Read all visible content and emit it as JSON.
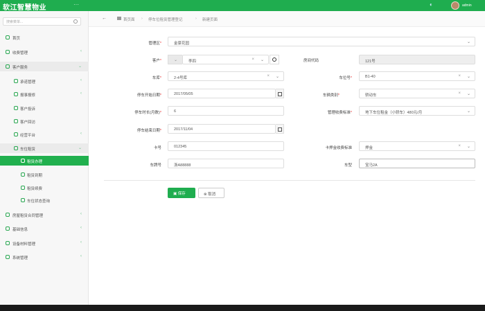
{
  "header": {
    "brand": "软江智慧物业",
    "menu_toggle": "···",
    "user": "admin",
    "colors": {
      "accent": "#1fad4f"
    }
  },
  "sidebar": {
    "search_placeholder": "搜索菜单...",
    "items": [
      {
        "label": "首页",
        "icon": "home-icon",
        "chevron": ""
      },
      {
        "label": "收费管理",
        "icon": "folder-icon",
        "chevron": "‹"
      },
      {
        "label": "客户服务",
        "icon": "headset-icon",
        "chevron": "⌄"
      },
      {
        "label": "承诺管理",
        "icon": "headset-icon",
        "chevron": "‹"
      },
      {
        "label": "报事报修",
        "icon": "headset-icon",
        "chevron": "‹"
      },
      {
        "label": "客户投诉",
        "icon": "headset-icon",
        "chevron": ""
      },
      {
        "label": "客户回访",
        "icon": "headset-icon",
        "chevron": ""
      },
      {
        "label": "经营平台",
        "icon": "headset-icon",
        "chevron": "‹"
      },
      {
        "label": "车位租赁",
        "icon": "headset-icon",
        "chevron": "⌄"
      },
      {
        "label": "租赁办理",
        "icon": "headset-icon",
        "chevron": ""
      },
      {
        "label": "租赁到期",
        "icon": "headset-icon",
        "chevron": ""
      },
      {
        "label": "租赁续费",
        "icon": "headset-icon",
        "chevron": ""
      },
      {
        "label": "车位状态查询",
        "icon": "headset-icon",
        "chevron": ""
      },
      {
        "label": "房屋租赁合同管理",
        "icon": "headset-icon",
        "chevron": "‹"
      },
      {
        "label": "基础信息",
        "icon": "headset-icon",
        "chevron": "‹"
      },
      {
        "label": "设备材料管理",
        "icon": "headset-icon",
        "chevron": "‹"
      },
      {
        "label": "系统管理",
        "icon": "headset-icon",
        "chevron": "‹"
      }
    ]
  },
  "breadcrumb": {
    "back": "←",
    "items": [
      "首页面",
      "停车位租赁管理登记",
      "新建页面"
    ],
    "separator": "›"
  },
  "form": {
    "labels": {
      "area": "管理区",
      "customer": "客户",
      "room": "房间代码",
      "garage": "车库",
      "space": "车位号",
      "start_date": "停车开始日期",
      "car_type": "车辆类别",
      "months": "停车时长(月数)",
      "fee_std": "管理收费标准",
      "end_date": "停车结束日期",
      "card_no": "卡号",
      "card_fee_std": "卡押金收费标准",
      "plate": "车牌号",
      "model": "车型"
    },
    "required_mark": "*",
    "values": {
      "area": "金豪花园",
      "customer": "李四",
      "room": "121号",
      "garage": "2-4号库",
      "space": "B1-40",
      "start_date": "2017/05/05",
      "car_type": "轿动车",
      "months": "6",
      "fee_std": "地下车位租金（小轿车）480元/月",
      "end_date": "2017/11/04",
      "card_no": "012345",
      "card_fee_std": "押金",
      "plate": "浙A88888",
      "model": "宝马2A"
    },
    "clear_glyph": "×",
    "caret_glyph": "⌄"
  },
  "actions": {
    "save": "▣ 保存",
    "cancel": "⊗ 取消"
  }
}
